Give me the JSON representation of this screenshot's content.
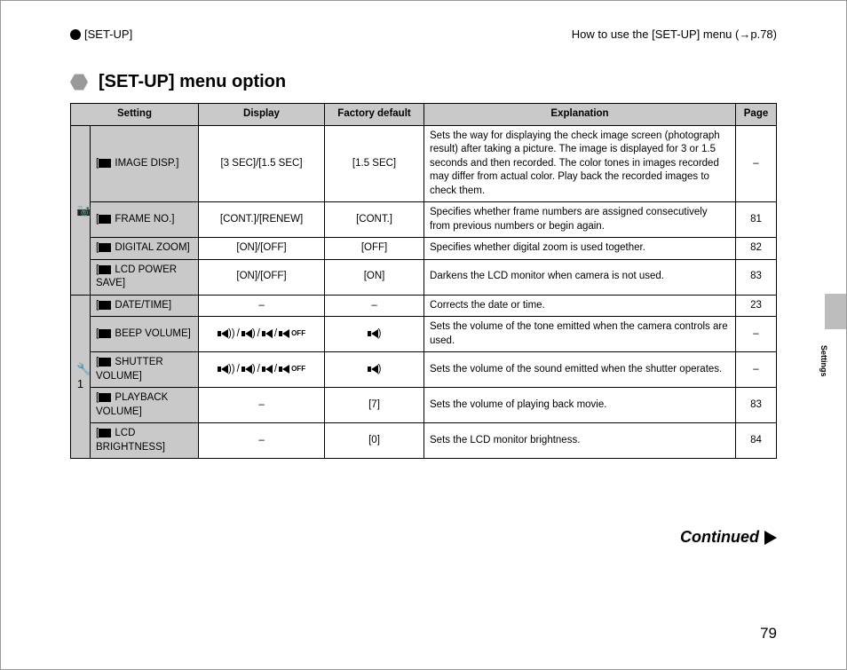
{
  "header": {
    "left_label": "[SET-UP]",
    "right_label": "How to use the [SET-UP] menu (→p.78)"
  },
  "title": "[SET-UP] menu option",
  "columns": {
    "setting": "Setting",
    "display": "Display",
    "factory": "Factory default",
    "explanation": "Explanation",
    "page": "Page"
  },
  "group_icons": {
    "camera": "📷",
    "wrench": "🔧1"
  },
  "rows": {
    "r1": {
      "setting": "IMAGE DISP.]",
      "display": "[3 SEC]/[1.5 SEC]",
      "factory": "[1.5 SEC]",
      "explanation": "Sets the way for displaying the check image screen (photograph result) after taking a picture. The image is displayed for 3 or 1.5 seconds and then recorded. The color tones in images recorded may differ from actual color. Play back the recorded images to check them.",
      "page": "–"
    },
    "r2": {
      "setting": "FRAME NO.]",
      "display": "[CONT.]/[RENEW]",
      "factory": "[CONT.]",
      "explanation": "Specifies whether frame numbers are assigned consecutively from previous numbers or begin again.",
      "page": "81"
    },
    "r3": {
      "setting": "DIGITAL ZOOM]",
      "display": "[ON]/[OFF]",
      "factory": "[OFF]",
      "explanation": "Specifies whether digital zoom is used together.",
      "page": "82"
    },
    "r4": {
      "setting": "LCD POWER SAVE]",
      "display": "[ON]/[OFF]",
      "factory": "[ON]",
      "explanation": "Darkens the LCD monitor when camera is not used.",
      "page": "83"
    },
    "r5": {
      "setting": "DATE/TIME]",
      "display": "–",
      "factory": "–",
      "explanation": "Corrects the date or time.",
      "page": "23"
    },
    "r6": {
      "setting": "BEEP VOLUME]",
      "display_off": "OFF",
      "explanation": "Sets the volume of the tone emitted when the camera controls are used.",
      "page": "–"
    },
    "r7": {
      "setting": "SHUTTER VOLUME]",
      "display_off": "OFF",
      "explanation": "Sets the volume of the sound emitted when the shutter operates.",
      "page": "–"
    },
    "r8": {
      "setting": "PLAYBACK VOLUME]",
      "display": "–",
      "factory": "[7]",
      "explanation": "Sets the volume of playing back movie.",
      "page": "83"
    },
    "r9": {
      "setting": "LCD BRIGHTNESS]",
      "display": "–",
      "factory": "[0]",
      "explanation": "Sets the LCD monitor brightness.",
      "page": "84"
    }
  },
  "continued": "Continued",
  "page_number": "79",
  "side_label": "Settings"
}
